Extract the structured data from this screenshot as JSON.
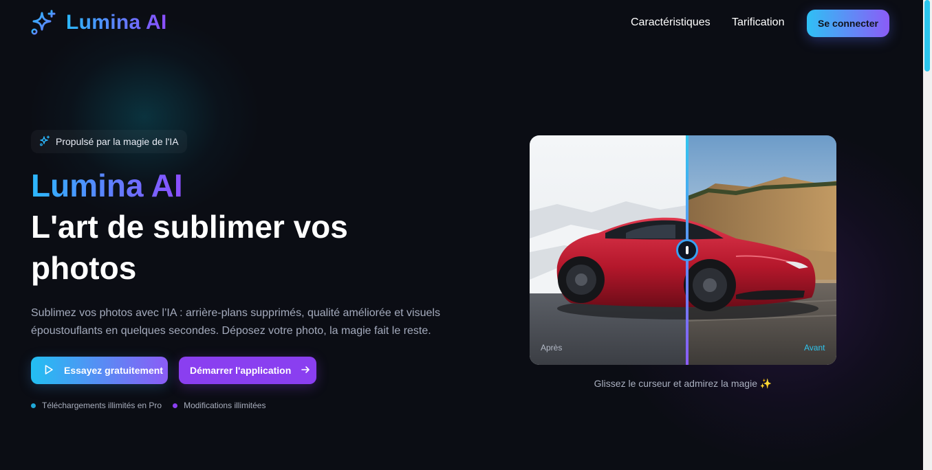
{
  "nav": {
    "brand": "Lumina AI",
    "links": [
      "Caractéristiques",
      "Tarification"
    ],
    "login_label": "Se connecter"
  },
  "hero": {
    "badge": "Propulsé par la magie de l'IA",
    "brand": "Lumina AI",
    "title": "L'art de sublimer vos photos",
    "description": "Sublimez vos photos avec l’IA : arrière-plans supprimés, qualité améliorée et visuels époustouflants en quelques secondes. Déposez votre photo, la magie fait le reste.",
    "cta_try": "Essayez gratuitement",
    "cta_start": "Démarrer l'application",
    "perks": [
      "Téléchargements illimités en Pro",
      "Modifications illimitées"
    ]
  },
  "compare": {
    "label_after": "Après",
    "label_before": "Avant",
    "slider_position": 0.51,
    "caption": "Glissez le curseur et admirez la magie ✨"
  },
  "colors": {
    "background": "#0b0d14",
    "accent_cyan": "#2bb8ff",
    "accent_purple": "#8c4dff",
    "perk_dot_1": "#1fa7d6",
    "perk_dot_2": "#8a3ff0"
  },
  "icons": {
    "logo": "sparkles-icon",
    "badge": "sparkles-icon",
    "cta_try": "play-icon",
    "cta_start": "arrow-right-icon",
    "slider": "slider-handle-icon"
  }
}
